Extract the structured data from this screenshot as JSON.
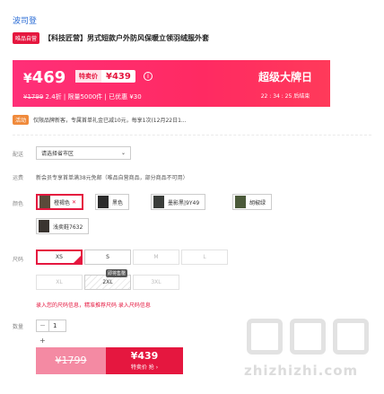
{
  "brand": "波司登",
  "product": {
    "badge": "唯品自营",
    "title": "【科技匠营】男式短款户外防风保暖立领羽绒服外套"
  },
  "price": {
    "main": "469",
    "currency": "¥",
    "tejia_label": "特卖价",
    "tejia_value": "¥439",
    "info_icon": "i",
    "original": "¥1799",
    "discount": "2.4折",
    "limit": "| 限量5000件 | 已优惠 ¥30"
  },
  "sale": {
    "title": "超级大牌日",
    "timer": "22 : 34 : 25",
    "timer_suffix": "后结束"
  },
  "coupon": {
    "tag": "活动",
    "text": "仅限品牌新客，专属首单礼金已减10元，每享1次(12月22日1..."
  },
  "labels": {
    "delivery": "配送",
    "shipping": "运费",
    "color": "颜色",
    "size": "尺码",
    "quantity": "数量"
  },
  "delivery": {
    "placeholder": "请选择省市区",
    "chevron": "⌄"
  },
  "shipping": {
    "text": "新会员专享首单满38元免邮（唯品自营商品，部分商品不可用）"
  },
  "colors": [
    {
      "label": "橙褐色",
      "swatch": "#5a4a3a",
      "selected": true
    },
    {
      "label": "黑色",
      "swatch": "#2b2b2b",
      "selected": false
    },
    {
      "label": "墨影黑|9Y49",
      "swatch": "#3a3d3a",
      "selected": false
    },
    {
      "label": "胡椒绿",
      "swatch": "#4b5a3a",
      "selected": false
    },
    {
      "label": "浅卖鞋7632",
      "swatch": "#3a3430",
      "selected": false
    }
  ],
  "sizes": {
    "xs": "XS",
    "s": "S",
    "m": "M",
    "l": "L",
    "xl": "XL",
    "xxl": "2XL",
    "xxxl": "3XL",
    "tip": "即将售罄"
  },
  "size_help": "录入您的尺码信息，精准推荐尺码  录入尺码信息",
  "quantity": {
    "value": "1",
    "minus": "−",
    "plus": "+"
  },
  "buttons": {
    "original_price": "¥1799",
    "buy_price": "¥439",
    "buy_sub": "特卖价 抢 ›"
  },
  "watermark": {
    "text": "zhizhizhi.com"
  }
}
